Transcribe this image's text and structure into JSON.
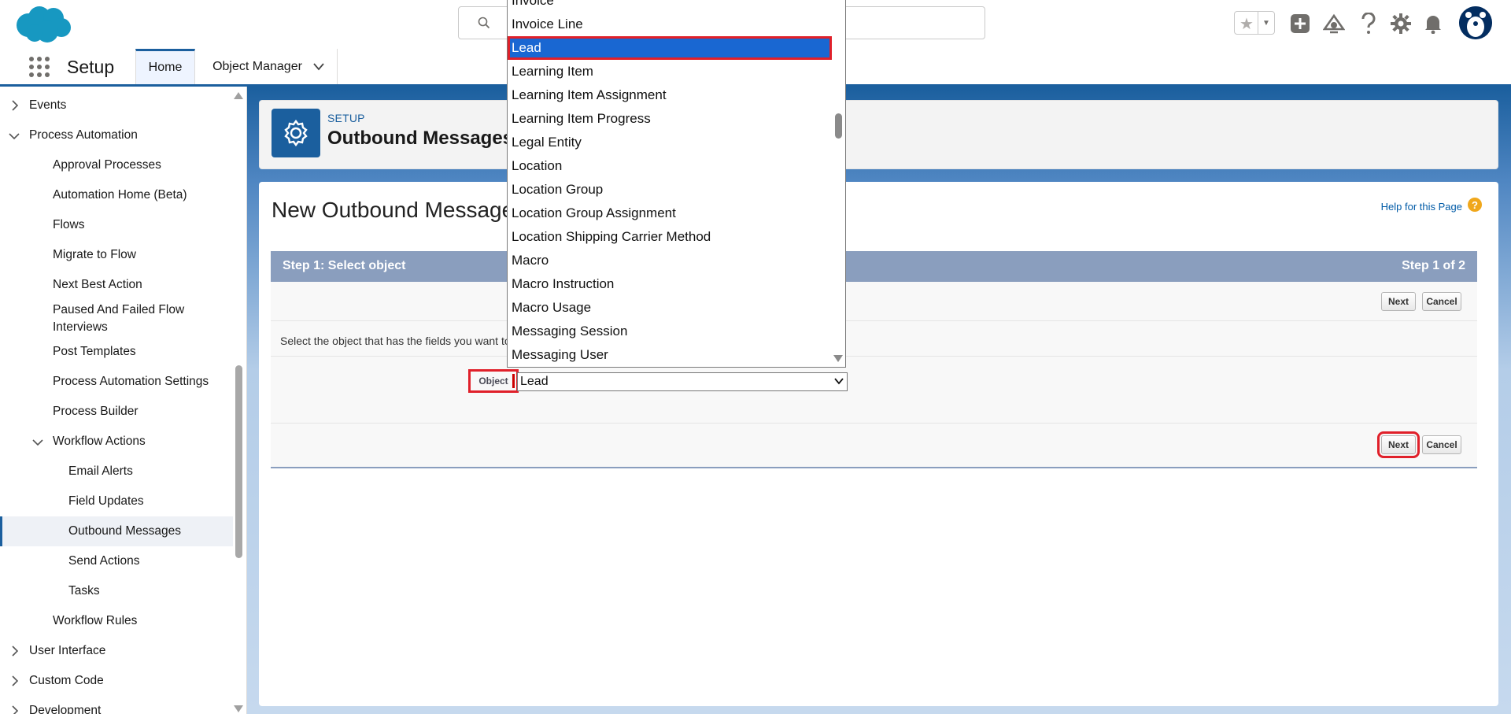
{
  "header": {
    "search_placeholder": ""
  },
  "app_nav": {
    "app_name": "Setup",
    "tabs": [
      {
        "label": "Home"
      },
      {
        "label": "Object Manager"
      }
    ]
  },
  "sidebar": {
    "items": [
      {
        "label": "Events",
        "expanded": false
      },
      {
        "label": "Process Automation",
        "expanded": true
      },
      {
        "label": "Approval Processes"
      },
      {
        "label": "Automation Home (Beta)"
      },
      {
        "label": "Flows"
      },
      {
        "label": "Migrate to Flow"
      },
      {
        "label": "Next Best Action"
      },
      {
        "label": "Paused And Failed Flow Interviews"
      },
      {
        "label": "Post Templates"
      },
      {
        "label": "Process Automation Settings"
      },
      {
        "label": "Process Builder"
      },
      {
        "label": "Workflow Actions",
        "expanded": true
      },
      {
        "label": "Email Alerts"
      },
      {
        "label": "Field Updates"
      },
      {
        "label": "Outbound Messages",
        "selected": true
      },
      {
        "label": "Send Actions"
      },
      {
        "label": "Tasks"
      },
      {
        "label": "Workflow Rules"
      },
      {
        "label": "User Interface",
        "expanded": false
      },
      {
        "label": "Custom Code",
        "expanded": false
      },
      {
        "label": "Development",
        "expanded": false
      }
    ]
  },
  "setup_header": {
    "eyebrow": "SETUP",
    "title": "Outbound Messages"
  },
  "page": {
    "title": "New Outbound Message",
    "help_link": "Help for this Page",
    "help_badge": "?"
  },
  "wizard": {
    "step_title": "Step 1: Select object",
    "step_count": "Step 1 of 2",
    "next_label": "Next",
    "cancel_label": "Cancel",
    "instruction": "Select the object that has the fields you want to send",
    "object_label": "Object",
    "object_value": "Lead"
  },
  "dropdown": {
    "options": [
      "Invoice",
      "Invoice Line",
      "Lead",
      "Learning Item",
      "Learning Item Assignment",
      "Learning Item Progress",
      "Legal Entity",
      "Location",
      "Location Group",
      "Location Group Assignment",
      "Location Shipping Carrier Method",
      "Macro",
      "Macro Instruction",
      "Macro Usage",
      "Messaging Session",
      "Messaging User"
    ],
    "selected": "Lead"
  },
  "colors": {
    "brand": "#1b5f9e",
    "step_bar": "#8a9ebe",
    "highlight": "#e0202a",
    "selected_option": "#1967d2"
  }
}
